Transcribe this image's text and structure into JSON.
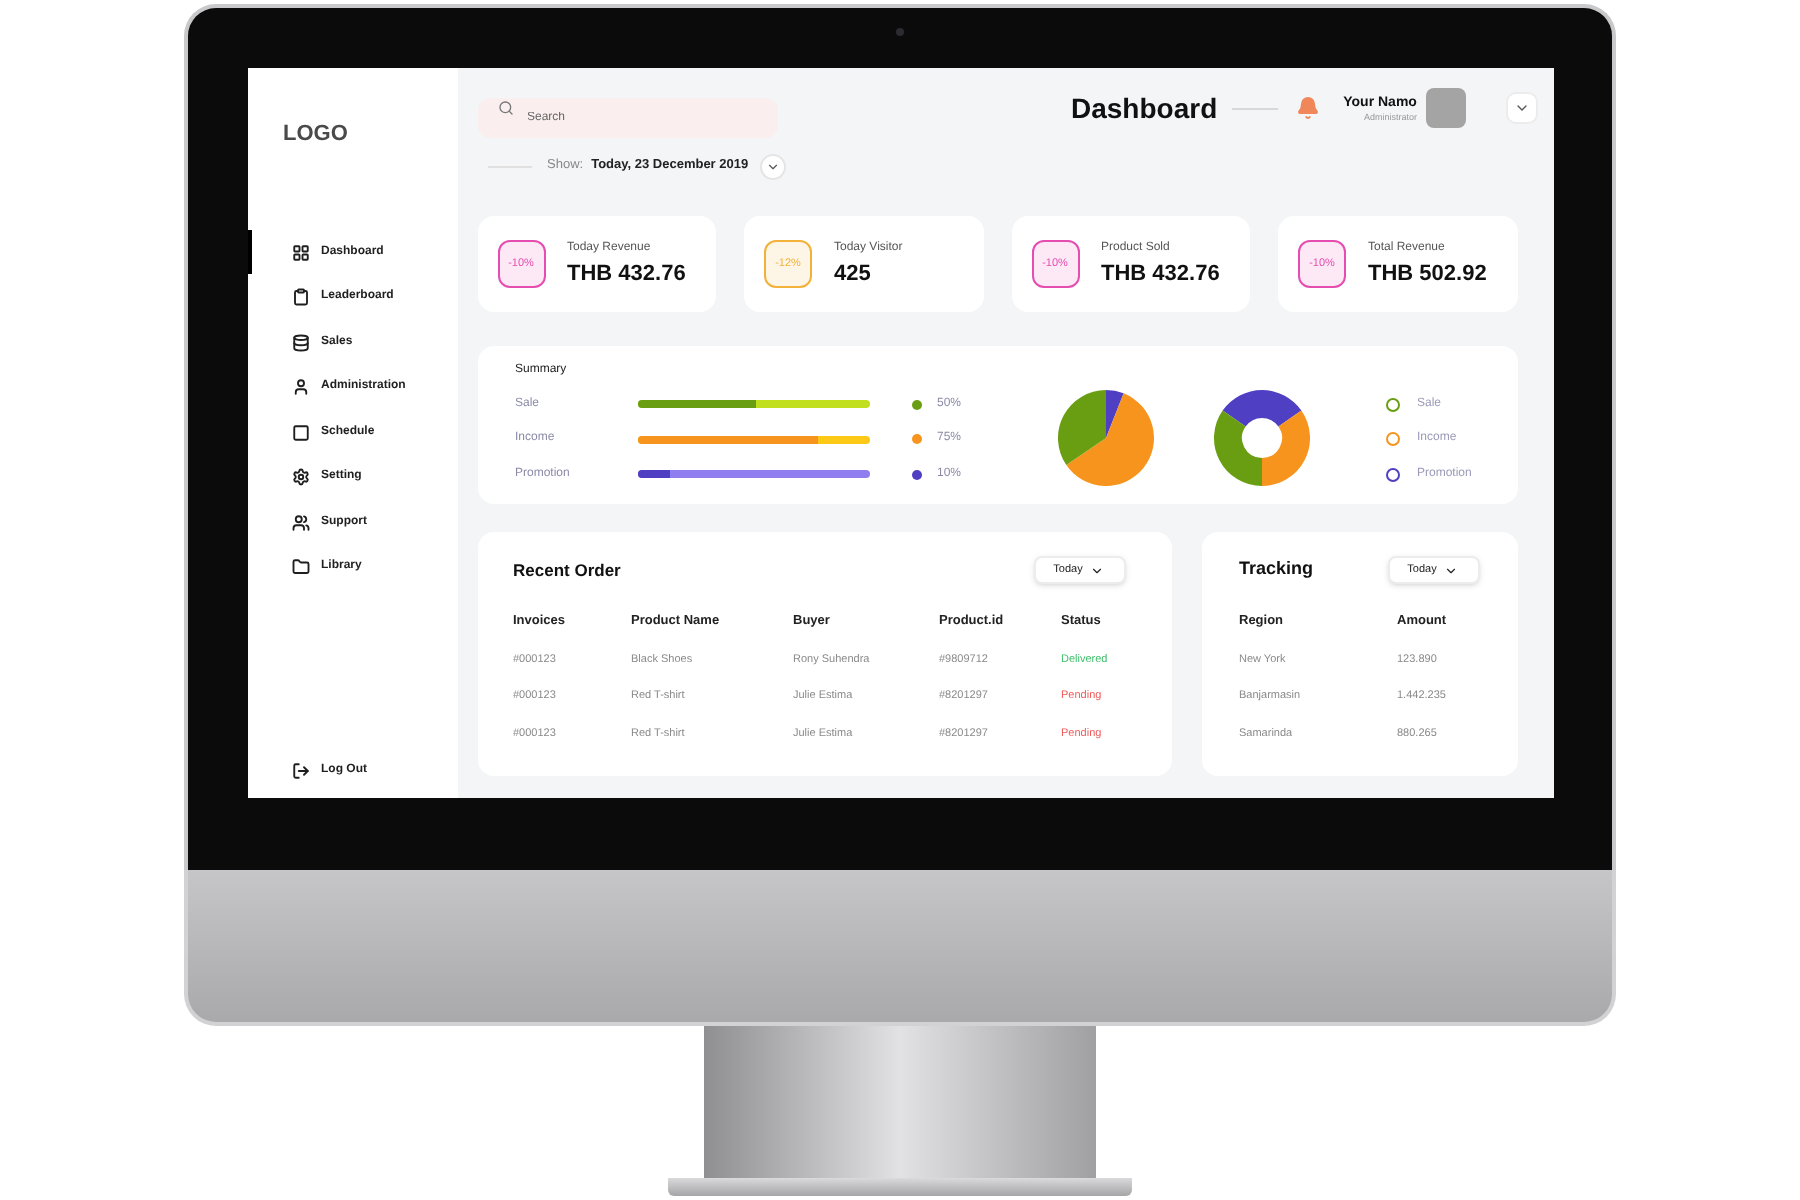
{
  "sidebar": {
    "logo": "LOGO",
    "items": [
      {
        "label": "Dashboard",
        "selected": true
      },
      {
        "label": "Leaderboard",
        "selected": false
      },
      {
        "label": "Sales",
        "selected": false
      },
      {
        "label": "Administration",
        "selected": false
      },
      {
        "label": "Schedule",
        "selected": false
      },
      {
        "label": "Setting",
        "selected": false
      },
      {
        "label": "Support",
        "selected": false
      },
      {
        "label": "Library",
        "selected": false
      }
    ],
    "logout": "Log Out"
  },
  "header": {
    "search": {
      "placeholder": "Search"
    },
    "title": "Dashboard",
    "user": {
      "name": "Your Namo",
      "role": "Administrator"
    },
    "show_label": "Show:",
    "date": "Today, 23 December 2019"
  },
  "stats": [
    {
      "change": "-10%",
      "color": "#e64db0",
      "label": "Today Revenue",
      "value": "THB 432.76"
    },
    {
      "change": "-12%",
      "color": "#f2b23a",
      "label": "Today Visitor",
      "value": "425"
    },
    {
      "change": "-10%",
      "color": "#e64db0",
      "label": "Product Sold",
      "value": "THB 432.76"
    },
    {
      "change": "-10%",
      "color": "#e64db0",
      "label": "Total Revenue",
      "value": "THB 502.92"
    }
  ],
  "summary": {
    "title": "Summary",
    "rows": [
      {
        "label": "Sale",
        "level": 0.51,
        "color": "#6a9e12",
        "track": {
          "color": "#c2df1f"
        },
        "reading": "50%"
      },
      {
        "label": "Income",
        "level": 0.78,
        "color": "#f7941d",
        "track": {
          "color": "#fcc916"
        },
        "reading": "75%"
      },
      {
        "label": "Promotion",
        "level": 0.14,
        "color": "#4f3fc2",
        "track": {
          "color": "#8f7ef0"
        },
        "reading": "10%"
      }
    ],
    "legend": [
      {
        "label": "Sale",
        "color": "#6a9e12"
      },
      {
        "label": "Income",
        "color": "#f7941d"
      },
      {
        "label": "Promotion",
        "color": "#4f3fc2"
      }
    ]
  },
  "recent_order": {
    "title": "Recent Order",
    "filter": "Today",
    "columns": [
      "Invoices",
      "Product Name",
      "Buyer",
      "Product.id",
      "Status"
    ],
    "rows": [
      {
        "cells": [
          "#000123",
          "Black Shoes",
          "Rony Suhendra",
          "#9809712"
        ],
        "status": {
          "text": "Delivered",
          "color": "#3fbf6b"
        }
      },
      {
        "cells": [
          "#000123",
          "Red T-shirt",
          "Julie Estima",
          "#8201297"
        ],
        "status": {
          "text": "Pending",
          "color": "#f05a5a"
        }
      },
      {
        "cells": [
          "#000123",
          "Red T-shirt",
          "Julie Estima",
          "#8201297"
        ],
        "status": {
          "text": "Pending",
          "color": "#f05a5a"
        }
      }
    ]
  },
  "tracking": {
    "title": "Tracking",
    "filter": "Today",
    "columns": [
      "Region",
      "Amount"
    ],
    "rows": [
      [
        "New York",
        "123.890"
      ],
      [
        "Banjarmasin",
        "1.442.235"
      ],
      [
        "Samarinda",
        "880.265"
      ]
    ]
  }
}
